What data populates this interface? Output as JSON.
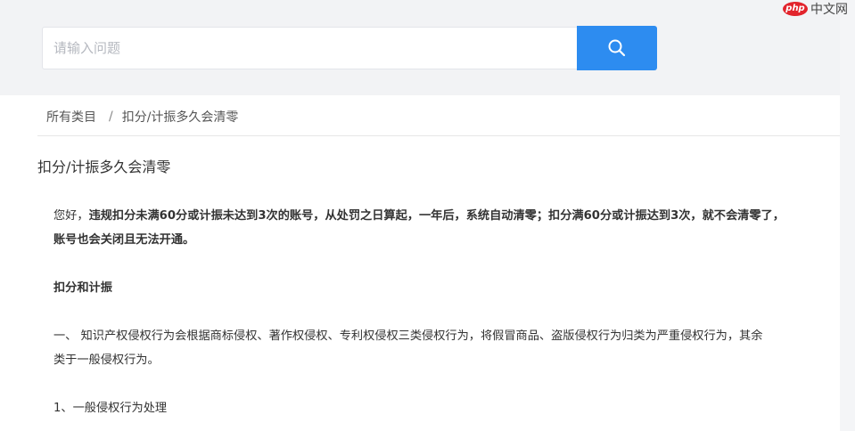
{
  "header": {
    "search_placeholder": "请输入问题"
  },
  "watermark": {
    "logo": "php",
    "text": "中文网"
  },
  "breadcrumb": {
    "root": "所有类目",
    "separator": "/",
    "current": "扣分/计振多久会清零"
  },
  "article": {
    "title": "扣分/计振多久会清零",
    "para1_prefix": "您好，",
    "para1_bold_line1": "违规扣分未满60分或计振未达到3次的账号，从处罚之日算起，一年后，系统自动清零；扣分满60分或计振达到3次，就不会清零了，",
    "para1_bold_line2": "账号也会关闭且无法开通。",
    "section_heading": "扣分和计振",
    "para2_line1": "一、 知识产权侵权行为会根据商标侵权、著作权侵权、专利权侵权三类侵权行为，将假冒商品、盗版侵权行为归类为严重侵权行为，其余",
    "para2_line2": "类于一般侵权行为。",
    "para3": "1、一般侵权行为处理"
  },
  "colors": {
    "accent": "#2d8cf0",
    "top_band": "#f2f3f5",
    "watermark_logo": "#e2242c"
  },
  "icons": {
    "search_button": "search-icon",
    "watermark_logo": "php-logo-icon"
  }
}
